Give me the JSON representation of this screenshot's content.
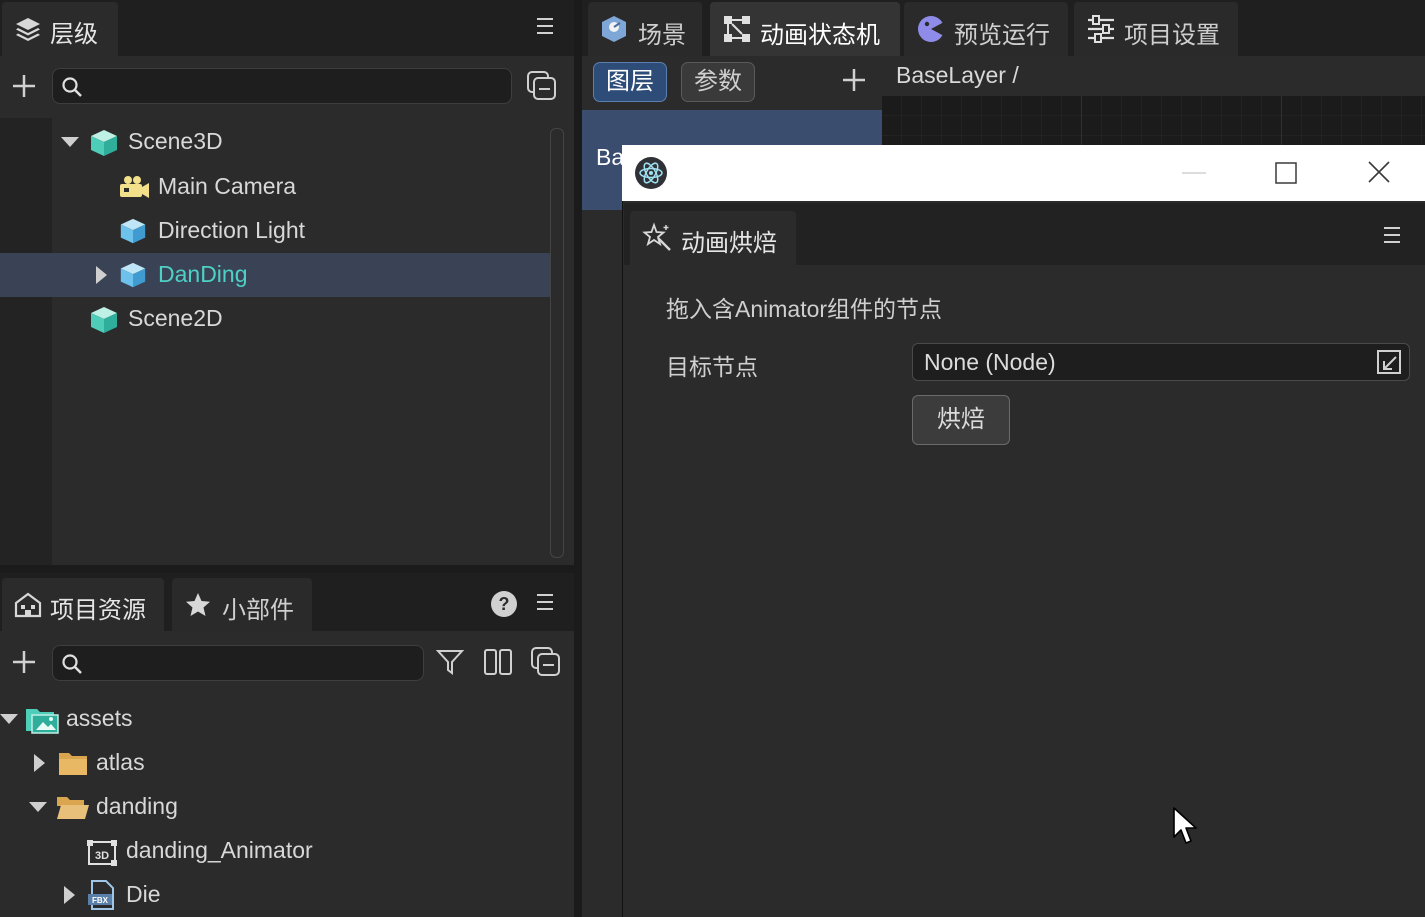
{
  "hierarchy": {
    "tab_label": "层级",
    "tree": [
      {
        "label": "Scene3D"
      },
      {
        "label": "Main Camera"
      },
      {
        "label": "Direction Light"
      },
      {
        "label": "DanDing"
      },
      {
        "label": "Scene2D"
      }
    ]
  },
  "assets_panel": {
    "tab_label": "项目资源",
    "tab2_label": "小部件",
    "tree": [
      {
        "label": "assets"
      },
      {
        "label": "atlas"
      },
      {
        "label": "danding"
      },
      {
        "label": "danding_Animator",
        "badge": "3D"
      },
      {
        "label": "Die",
        "badge": "FBX"
      }
    ]
  },
  "editor": {
    "tabs": [
      {
        "label": "场景"
      },
      {
        "label": "动画状态机"
      },
      {
        "label": "预览运行"
      },
      {
        "label": "项目设置"
      }
    ],
    "subtabs": [
      {
        "label": "图层"
      },
      {
        "label": "参数"
      }
    ],
    "breadcrumb": "BaseLayer  /",
    "layer_item_partial": "Ba"
  },
  "bake_window": {
    "panel_tab_label": "动画烘焙",
    "hint": "拖入含Animator组件的节点",
    "target_label": "目标节点",
    "target_value": "None (Node)",
    "bake_button": "烘焙"
  },
  "colors": {
    "accent_blue": "#2d4d78",
    "selected_text": "#4fd0c4",
    "panel_bg": "#2b2b2b",
    "tabbar_bg": "#1f1f1f"
  },
  "icons": [
    "layers-icon",
    "menu-icon",
    "plus-icon",
    "search-icon",
    "collapse-icon",
    "cube-icon",
    "camera-icon",
    "home-icon",
    "star-icon",
    "help-icon",
    "filter-icon",
    "columns-icon",
    "folder-icon",
    "scene-icon",
    "state-machine-icon",
    "play-icon",
    "settings-icon",
    "app-logo-icon",
    "minimize-icon",
    "maximize-icon",
    "close-icon",
    "magic-wand-icon",
    "node-picker-icon",
    "cursor-icon"
  ]
}
